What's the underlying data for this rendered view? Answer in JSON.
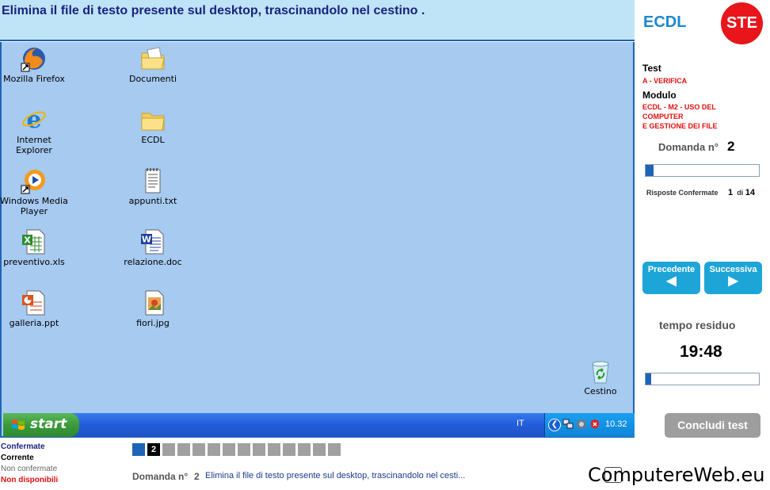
{
  "question": {
    "text": "Elimina il file di testo presente sul desktop, trascinandolo nel cestino ."
  },
  "desktop": {
    "icons": [
      {
        "label": "Mozilla Firefox",
        "icon": "firefox-icon"
      },
      {
        "label": "Internet Explorer",
        "icon": "internet-explorer-icon"
      },
      {
        "label": "Windows Media Player",
        "icon": "media-player-icon"
      },
      {
        "label": "preventivo.xls",
        "icon": "excel-file-icon"
      },
      {
        "label": "galleria.ppt",
        "icon": "powerpoint-file-icon"
      },
      {
        "label": "Documenti",
        "icon": "my-documents-folder-icon"
      },
      {
        "label": "ECDL",
        "icon": "folder-icon"
      },
      {
        "label": "appunti.txt",
        "icon": "text-file-icon"
      },
      {
        "label": "relazione.doc",
        "icon": "word-file-icon"
      },
      {
        "label": "fiori.jpg",
        "icon": "image-file-icon"
      },
      {
        "label": "Cestino",
        "icon": "recycle-bin-icon"
      }
    ]
  },
  "taskbar": {
    "start_label": "start",
    "language": "IT",
    "clock": "10.32"
  },
  "panel": {
    "brand": "ECDL",
    "logo_text": "STE",
    "test_label": "Test",
    "test_value": "A - VERIFICA",
    "module_label": "Modulo",
    "module_value_1": "ECDL - M2 - USO DEL",
    "module_value_2": "COMPUTER",
    "module_value_3": "E GESTIONE DEI FILE",
    "question_number_label": "Domanda n°",
    "question_number": "2",
    "question_progress": 0.07,
    "answers_label": "Risposte Confermate",
    "answers_confirmed": "1",
    "answers_of": "di",
    "answers_total": "14",
    "prev_label": "Precedente",
    "next_label": "Successiva",
    "time_label": "tempo residuo",
    "time_value": "19:48",
    "time_progress": 0.05,
    "finish_label": "Concludi test"
  },
  "legend": {
    "confirmed": "Confermate",
    "current": "Corrente",
    "not_confirmed": "Non confermate",
    "unavailable": "Non disponibili"
  },
  "question_squares": {
    "total": 14,
    "confirmed": [
      1
    ],
    "current": 2,
    "current_label": "2"
  },
  "bottom": {
    "question_label": "Domanda n°",
    "question_number": "2",
    "question_text": "Elimina il file di testo presente sul desktop, trascinandolo nel cesti..."
  },
  "watermark": "ComputereWeb.eu",
  "colors": {
    "accent": "#1e63b8",
    "desktop": "#a6caf0",
    "red": "#e01010",
    "nav": "#1ea5d8"
  }
}
